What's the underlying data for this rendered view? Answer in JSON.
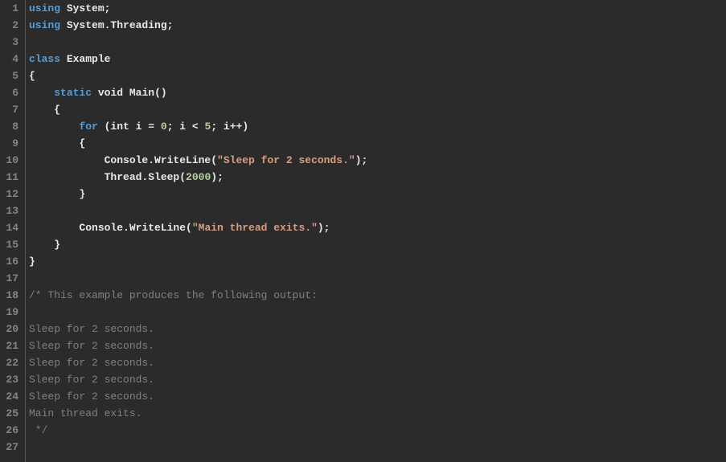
{
  "editor": {
    "lines": [
      {
        "n": 1,
        "tokens": [
          {
            "t": "using ",
            "c": "kw"
          },
          {
            "t": "System",
            "c": "ident"
          },
          {
            "t": ";",
            "c": "punct"
          }
        ]
      },
      {
        "n": 2,
        "tokens": [
          {
            "t": "using ",
            "c": "kw"
          },
          {
            "t": "System.Threading",
            "c": "ident"
          },
          {
            "t": ";",
            "c": "punct"
          }
        ]
      },
      {
        "n": 3,
        "tokens": []
      },
      {
        "n": 4,
        "tokens": [
          {
            "t": "class ",
            "c": "kw"
          },
          {
            "t": "Example",
            "c": "ident"
          }
        ]
      },
      {
        "n": 5,
        "tokens": [
          {
            "t": "{",
            "c": "punct"
          }
        ]
      },
      {
        "n": 6,
        "tokens": [
          {
            "t": "    ",
            "c": ""
          },
          {
            "t": "static",
            "c": "kw"
          },
          {
            "t": " ",
            "c": ""
          },
          {
            "t": "void",
            "c": "white"
          },
          {
            "t": " ",
            "c": ""
          },
          {
            "t": "Main()",
            "c": "ident"
          }
        ]
      },
      {
        "n": 7,
        "tokens": [
          {
            "t": "    {",
            "c": "punct"
          }
        ]
      },
      {
        "n": 8,
        "tokens": [
          {
            "t": "        ",
            "c": ""
          },
          {
            "t": "for",
            "c": "kw"
          },
          {
            "t": " ",
            "c": ""
          },
          {
            "t": "(",
            "c": "punct"
          },
          {
            "t": "int",
            "c": "white"
          },
          {
            "t": " i = ",
            "c": "white"
          },
          {
            "t": "0",
            "c": "num"
          },
          {
            "t": "; i < ",
            "c": "white"
          },
          {
            "t": "5",
            "c": "num"
          },
          {
            "t": "; i++)",
            "c": "white"
          }
        ]
      },
      {
        "n": 9,
        "tokens": [
          {
            "t": "        {",
            "c": "punct"
          }
        ]
      },
      {
        "n": 10,
        "tokens": [
          {
            "t": "            Console.WriteLine(",
            "c": "white"
          },
          {
            "t": "\"Sleep for 2 seconds.\"",
            "c": "str"
          },
          {
            "t": ");",
            "c": "white"
          }
        ]
      },
      {
        "n": 11,
        "tokens": [
          {
            "t": "            Thread.Sleep(",
            "c": "white"
          },
          {
            "t": "2000",
            "c": "num"
          },
          {
            "t": ");",
            "c": "white"
          }
        ]
      },
      {
        "n": 12,
        "tokens": [
          {
            "t": "        }",
            "c": "punct"
          }
        ]
      },
      {
        "n": 13,
        "tokens": []
      },
      {
        "n": 14,
        "tokens": [
          {
            "t": "        Console.WriteLine(",
            "c": "white"
          },
          {
            "t": "\"Main thread exits.\"",
            "c": "str"
          },
          {
            "t": ");",
            "c": "white"
          }
        ]
      },
      {
        "n": 15,
        "tokens": [
          {
            "t": "    }",
            "c": "punct"
          }
        ]
      },
      {
        "n": 16,
        "tokens": [
          {
            "t": "}",
            "c": "punct"
          }
        ]
      },
      {
        "n": 17,
        "tokens": []
      },
      {
        "n": 18,
        "tokens": [
          {
            "t": "/* This example produces the following output:",
            "c": "comment"
          }
        ]
      },
      {
        "n": 19,
        "tokens": []
      },
      {
        "n": 20,
        "tokens": [
          {
            "t": "Sleep for 2 seconds.",
            "c": "comment"
          }
        ]
      },
      {
        "n": 21,
        "tokens": [
          {
            "t": "Sleep for 2 seconds.",
            "c": "comment"
          }
        ]
      },
      {
        "n": 22,
        "tokens": [
          {
            "t": "Sleep for 2 seconds.",
            "c": "comment"
          }
        ]
      },
      {
        "n": 23,
        "tokens": [
          {
            "t": "Sleep for 2 seconds.",
            "c": "comment"
          }
        ]
      },
      {
        "n": 24,
        "tokens": [
          {
            "t": "Sleep for 2 seconds.",
            "c": "comment"
          }
        ]
      },
      {
        "n": 25,
        "tokens": [
          {
            "t": "Main thread exits.",
            "c": "comment"
          }
        ]
      },
      {
        "n": 26,
        "tokens": [
          {
            "t": " */",
            "c": "comment"
          }
        ]
      },
      {
        "n": 27,
        "tokens": []
      }
    ]
  }
}
